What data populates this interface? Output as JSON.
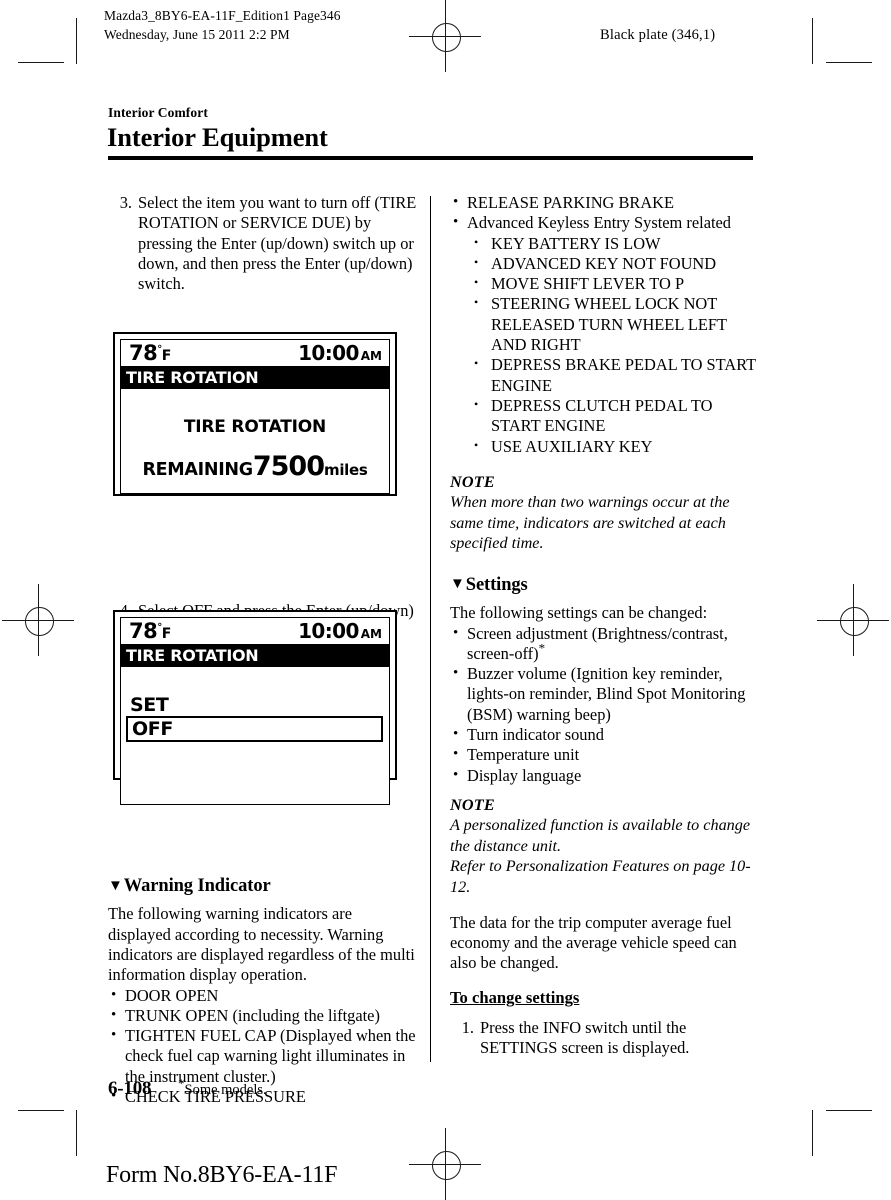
{
  "running_head": {
    "left_line1": "Mazda3_8BY6-EA-11F_Edition1 Page346",
    "left_line2": "Wednesday, June 15 2011 2:2 PM",
    "right": "Black plate (346,1)"
  },
  "chapter": {
    "kicker": "Interior Comfort",
    "title": "Interior Equipment"
  },
  "left_column": {
    "step3": {
      "num": "3.",
      "text": "Select the item you want to turn off (TIRE ROTATION or SERVICE DUE) by pressing the Enter (up/down) switch up or down, and then press the Enter (up/down) switch."
    },
    "display1": {
      "temp": "78",
      "degree": "°",
      "temp_unit": "F",
      "clock": "10:00",
      "ampm": "AM",
      "title": "TIRE ROTATION",
      "center_text": "TIRE ROTATION",
      "remaining_label": "REMAINING",
      "remaining_value": "7500",
      "remaining_unit": "miles"
    },
    "step4": {
      "num": "4.",
      "text": "Select OFF and press the Enter (up/down) switch."
    },
    "display2": {
      "temp": "78",
      "degree": "°",
      "temp_unit": "F",
      "clock": "10:00",
      "ampm": "AM",
      "title": "TIRE ROTATION",
      "menu": [
        "SET",
        "OFF"
      ],
      "selected": "OFF"
    },
    "warning_indicator": {
      "triangle": "▼",
      "heading": "Warning Indicator",
      "intro": "The following warning indicators are displayed according to necessity. Warning indicators are displayed regardless of the multi information display operation.",
      "items": [
        "DOOR OPEN",
        "TRUNK OPEN (including the liftgate)",
        "TIGHTEN FUEL CAP (Displayed when the check fuel cap warning light illuminates in the instrument cluster.)",
        "CHECK TIRE PRESSURE"
      ]
    }
  },
  "right_column": {
    "warning_items_cont": [
      "RELEASE PARKING BRAKE",
      "Advanced Keyless Entry System related"
    ],
    "keyless_subitems": [
      "KEY BATTERY IS LOW",
      "ADVANCED KEY NOT FOUND",
      "MOVE SHIFT LEVER TO P",
      "STEERING WHEEL LOCK NOT RELEASED TURN WHEEL LEFT AND RIGHT",
      "DEPRESS BRAKE PEDAL TO START ENGINE",
      "DEPRESS CLUTCH PEDAL TO START ENGINE",
      "USE AUXILIARY KEY"
    ],
    "note1": {
      "label": "NOTE",
      "body": "When more than two warnings occur at the same time, indicators are switched at each specified time."
    },
    "settings": {
      "triangle": "▼",
      "heading": "Settings",
      "intro": "The following settings can be changed:",
      "items_pre": "Screen adjustment (Brightness/contrast, screen-off)",
      "items_pre_asterisk": "*",
      "items": [
        "Buzzer volume (Ignition key reminder, lights-on reminder, Blind Spot Monitoring (BSM) warning beep)",
        "Turn indicator sound",
        "Temperature unit",
        "Display language"
      ]
    },
    "note2": {
      "label": "NOTE",
      "body_line1": "A personalized function is available to change the distance unit.",
      "body_line2": "Refer to Personalization Features on page 10-12."
    },
    "trip_para": "The data for the trip computer average fuel economy and the average vehicle speed can also be changed.",
    "to_change": {
      "heading": "To change settings",
      "step1_num": "1.",
      "step1_text": "Press the INFO switch until the SETTINGS screen is displayed."
    }
  },
  "footer": {
    "page_number": "6-108",
    "footnote_asterisk": "*",
    "footnote": "Some models.",
    "form_no": "Form No.8BY6-EA-11F"
  }
}
